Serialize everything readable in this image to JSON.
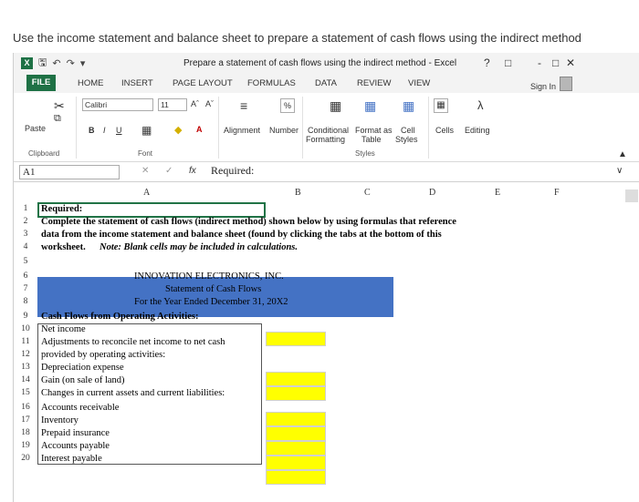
{
  "prompt": "Use the income statement and balance sheet to prepare a statement of cash flows using the indirect method",
  "window": {
    "title": "Prepare a statement of cash flows using the indirect method - Excel",
    "help": "?",
    "minimize": "-",
    "restore": "□",
    "close": "✕"
  },
  "tabs": [
    "FILE",
    "HOME",
    "INSERT",
    "PAGE LAYOUT",
    "FORMULAS",
    "DATA",
    "REVIEW",
    "VIEW"
  ],
  "signin": "Sign In",
  "ribbon": {
    "paste": "Paste",
    "clipboard": "Clipboard",
    "font_name": "Calibri",
    "font_size": "11",
    "bold": "B",
    "italic": "I",
    "underline": "U",
    "grow": "Aˆ",
    "shrink": "Aˇ",
    "font_color": "A",
    "font_group": "Font",
    "alignment": "Alignment",
    "number": "Number",
    "percent": "%",
    "conditional_formatting_1": "Conditional",
    "conditional_formatting_2": "Formatting",
    "format_as_table_1": "Format as",
    "format_as_table_2": "Table",
    "cell_styles_1": "Cell",
    "cell_styles_2": "Styles",
    "styles_group": "Styles",
    "cells": "Cells",
    "editing": "Editing"
  },
  "formula_bar": {
    "name_box": "A1",
    "cancel": "✕",
    "enter": "✓",
    "fx": "fx",
    "content": "Required:"
  },
  "columns": [
    "A",
    "B",
    "C",
    "D",
    "E",
    "F"
  ],
  "rows": [
    {
      "n": "1",
      "text": "Required:"
    },
    {
      "n": "2",
      "text": "Complete the statement of cash flows (indirect method) shown below by using formulas that reference"
    },
    {
      "n": "3",
      "text": "data from the income statement and balance sheet (found by clicking the tabs at the bottom of this"
    },
    {
      "n": "4",
      "text": "worksheet.",
      "note": "Note: Blank cells may be included in calculations."
    },
    {
      "n": "5",
      "text": ""
    },
    {
      "n": "6",
      "text": "INNOVATION ELECTRONICS, INC."
    },
    {
      "n": "7",
      "text": "Statement of Cash Flows"
    },
    {
      "n": "8",
      "text": "For the Year Ended December 31, 20X2"
    },
    {
      "n": "9",
      "text": "Cash Flows from Operating Activities:"
    },
    {
      "n": "10",
      "text": "Net income"
    },
    {
      "n": "11",
      "text": "Adjustments to reconcile net income to net cash"
    },
    {
      "n": "12",
      "text": "provided by operating activities:"
    },
    {
      "n": "13",
      "text": "Depreciation expense"
    },
    {
      "n": "14",
      "text": "Gain (on sale of land)"
    },
    {
      "n": "15",
      "text": "Changes in current assets and current liabilities:"
    },
    {
      "n": "16",
      "text": "Accounts receivable"
    },
    {
      "n": "17",
      "text": "Inventory"
    },
    {
      "n": "18",
      "text": "Prepaid insurance"
    },
    {
      "n": "19",
      "text": "Accounts payable"
    },
    {
      "n": "20",
      "text": "Interest payable"
    }
  ],
  "colors": {
    "header_band": "#4472c4",
    "input_cell": "#ffff00",
    "excel_green": "#1e7145"
  }
}
